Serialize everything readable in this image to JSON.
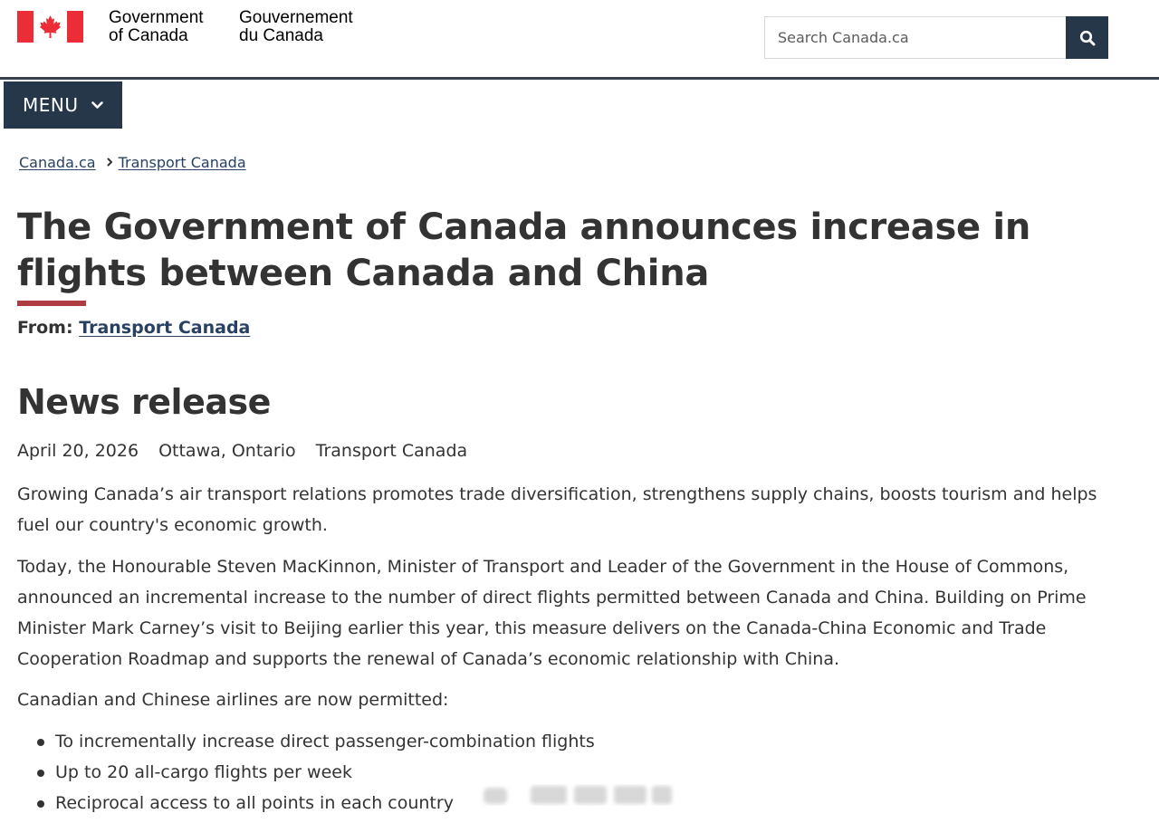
{
  "header": {
    "signature_en_line1": "Government",
    "signature_en_line2": "of Canada",
    "signature_fr_line1": "Gouvernement",
    "signature_fr_line2": "du Canada",
    "search_placeholder": "Search Canada.ca",
    "search_icon": "search-icon",
    "flag_icon": "canada-flag-icon",
    "brand_color": "#26374a",
    "flag_color": "#eb2d37"
  },
  "menu": {
    "label": "MENU",
    "icon": "chevron-down-icon"
  },
  "breadcrumb": {
    "items": [
      "Canada.ca",
      "Transport Canada"
    ],
    "separator_icon": "chevron-right-icon"
  },
  "article": {
    "title": "The Government of Canada announces increase in flights between Canada and China",
    "accent_color": "#af3c43",
    "from_label": "From:",
    "from_link": "Transport Canada",
    "section_title": "News release",
    "meta": {
      "date": "April 20, 2026",
      "location": "Ottawa, Ontario",
      "department": "Transport Canada"
    },
    "paragraphs": [
      "Growing Canada’s air transport relations promotes trade diversification, strengthens supply chains, boosts tourism and helps fuel our country's economic growth.",
      "Today, the Honourable Steven MacKinnon, Minister of Transport and Leader of the Government in the House of Commons, announced an incremental increase to the number of direct flights permitted between Canada and China. Building on Prime Minister Mark Carney’s visit to Beijing earlier this year, this measure delivers on the Canada-China Economic and Trade Cooperation Roadmap and supports the renewal of Canada’s economic relationship with China.",
      "Canadian and Chinese airlines are now permitted:"
    ],
    "bullets": [
      "To incrementally increase direct passenger-combination flights",
      "Up to 20 all-cargo flights per week",
      "Reciprocal access to all points in each country"
    ]
  }
}
